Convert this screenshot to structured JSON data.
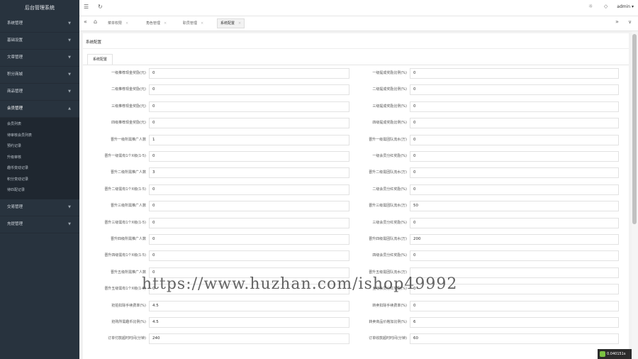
{
  "sidebar": {
    "brand": "后台管理系统",
    "menu": [
      "系统管理",
      "基础设置",
      "文章管理",
      "积分商城",
      "商品管理",
      "会员管理"
    ],
    "submenu": [
      "会员列表",
      "待审核会员列表",
      "预约记录",
      "升级审核",
      "趣币变动记录",
      "积分变动记录",
      "待匹配记录"
    ],
    "menu_after": [
      "交易管理",
      "充提管理"
    ]
  },
  "topbar": {
    "menu_icon": "☰",
    "refresh_icon": "↻",
    "user": "admin ▾"
  },
  "tabs": {
    "prev_icon": "«",
    "home_icon": "⌂",
    "items": [
      "菜单权限",
      "角色管理",
      "职员管理",
      "系统配置"
    ],
    "close": "×",
    "next_icon": "»",
    "more_icon": "∨"
  },
  "page": {
    "title": "系统配置",
    "subtab": "系统配置"
  },
  "form": {
    "left": [
      {
        "label": "一级推荐现金奖励(元)",
        "value": "0"
      },
      {
        "label": "二级推荐现金奖励(元)",
        "value": "0"
      },
      {
        "label": "三级推荐现金奖励(元)",
        "value": "0"
      },
      {
        "label": "四级推荐现金奖励(元)",
        "value": "0"
      },
      {
        "label": "晋升一级所需推广人数",
        "value": "1"
      },
      {
        "label": "晋升一级需有1个X级(1-5)",
        "value": "0"
      },
      {
        "label": "晋升二级所需推广人数",
        "value": "3"
      },
      {
        "label": "晋升二级需有1个X级(1-5)",
        "value": "0"
      },
      {
        "label": "晋升三级所需推广人数",
        "value": "0"
      },
      {
        "label": "晋升三级需有1个X级(1-5)",
        "value": "0"
      },
      {
        "label": "晋升四级所需推广人数",
        "value": "0"
      },
      {
        "label": "晋升四级需有1个X级(1-5)",
        "value": "0"
      },
      {
        "label": "晋升五级所需推广人数",
        "value": "0"
      },
      {
        "label": "晋升五级需有1个X级(1-5)",
        "value": "0"
      },
      {
        "label": "抢拍扣除手续费率(%)",
        "value": "4.5"
      },
      {
        "label": "抢购所需趣币比例(%)",
        "value": "4.5"
      },
      {
        "label": "订单付款超时时间(分钟)",
        "value": "240"
      }
    ],
    "right": [
      {
        "label": "一级提成奖励比例(%)",
        "value": "0"
      },
      {
        "label": "二级提成奖励比例(%)",
        "value": "0"
      },
      {
        "label": "三级提成奖励比例(%)",
        "value": "0"
      },
      {
        "label": "四级提成奖励比例(%)",
        "value": "0"
      },
      {
        "label": "晋升一级需团队流水(万)",
        "value": "0"
      },
      {
        "label": "一级会员分红奖励(%)",
        "value": "0"
      },
      {
        "label": "晋升二级需团队流水(万)",
        "value": "0"
      },
      {
        "label": "二级会员分红奖励(%)",
        "value": "0"
      },
      {
        "label": "晋升三级需团队流水(万)",
        "value": "50"
      },
      {
        "label": "三级会员分红奖励(%)",
        "value": "0"
      },
      {
        "label": "晋升四级需团队流水(万)",
        "value": "200"
      },
      {
        "label": "四级会员分红奖励(%)",
        "value": "0"
      },
      {
        "label": "晋升五级需团队流水(万)",
        "value": ""
      },
      {
        "label": "五级会员分红奖励(%)",
        "value": "0"
      },
      {
        "label": "转卖扣除手续费率(%)",
        "value": "0"
      },
      {
        "label": "转卖商品价格加比例(%)",
        "value": "6"
      },
      {
        "label": "订单收款超时时间(分钟)",
        "value": "60"
      }
    ]
  },
  "watermark": "https://www.huzhan.com/ishop49992",
  "perf": "0.040151s"
}
